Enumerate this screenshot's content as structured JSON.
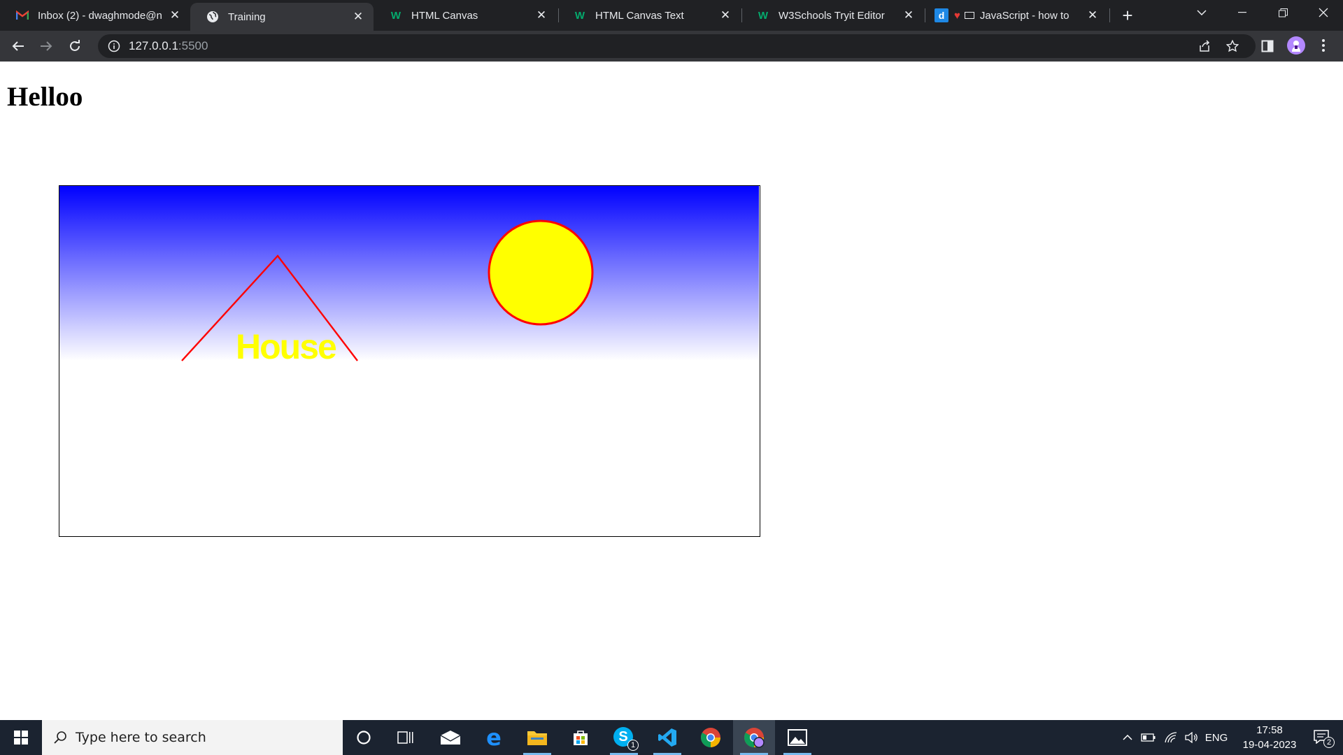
{
  "browser": {
    "tabs": [
      {
        "title": "Inbox (2) - dwaghmode@n",
        "icon": "gmail-icon"
      },
      {
        "title": "Training",
        "icon": "globe-icon"
      },
      {
        "title": "HTML Canvas",
        "icon": "w3schools-icon"
      },
      {
        "title": "HTML Canvas Text",
        "icon": "w3schools-icon"
      },
      {
        "title": "W3Schools Tryit Editor",
        "icon": "w3schools-icon"
      },
      {
        "title": "JavaScript - how to",
        "icon": "d-icon"
      }
    ],
    "active_tab": 1,
    "address": {
      "host": "127.0.0.1",
      "port": ":5500"
    }
  },
  "page": {
    "heading": "Helloo",
    "canvas": {
      "label": "House",
      "colors": {
        "sky_top": "#0000ff",
        "sky_bottom": "#ffffff",
        "roof": "#ff0000",
        "sun_fill": "#ffff00",
        "sun_stroke": "#ff0000",
        "label": "#ffff00"
      }
    }
  },
  "taskbar": {
    "search_placeholder": "Type here to search",
    "skype_badge": "1",
    "tray_language": "ENG",
    "clock_time": "17:58",
    "clock_date": "19-04-2023",
    "notification_count": "2"
  }
}
